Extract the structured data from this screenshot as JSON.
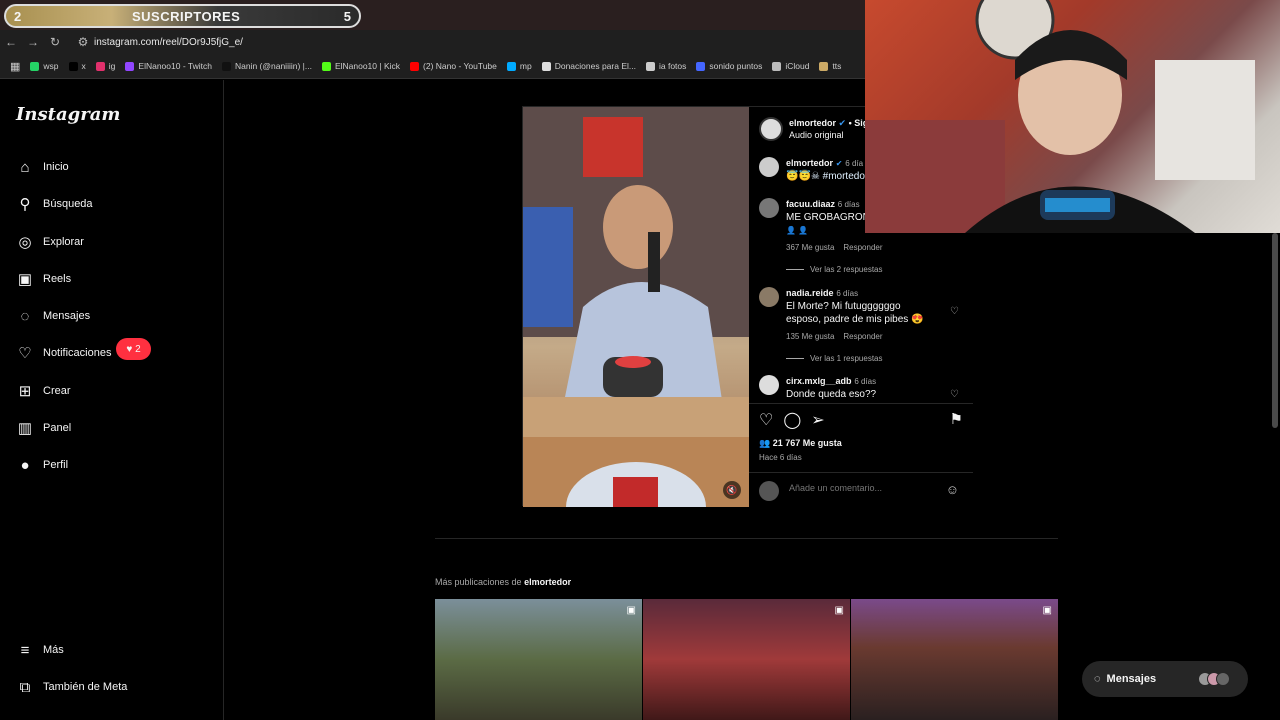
{
  "overlay": {
    "left_num": "2",
    "label": "SUSCRIPTORES",
    "right_num": "5"
  },
  "browser": {
    "url": "instagram.com/reel/DOr9J5fjG_e/"
  },
  "bookmarks": [
    {
      "label": "wsp",
      "color": "#25d366"
    },
    {
      "label": "x",
      "color": "#000000"
    },
    {
      "label": "ig",
      "color": "#e1306c"
    },
    {
      "label": "ElNanoo10 - Twitch",
      "color": "#9146ff"
    },
    {
      "label": "Nanin (@naniiiin) |...",
      "color": "#111111"
    },
    {
      "label": "ElNanoo10 | Kick",
      "color": "#53fc18"
    },
    {
      "label": "(2) Nano - YouTube",
      "color": "#ff0000"
    },
    {
      "label": "mp",
      "color": "#00aaff"
    },
    {
      "label": "Donaciones para El...",
      "color": "#dddddd"
    },
    {
      "label": "ia fotos",
      "color": "#cccccc"
    },
    {
      "label": "sonido puntos",
      "color": "#4466ff"
    },
    {
      "label": "iCloud",
      "color": "#bbbbbb"
    },
    {
      "label": "tts",
      "color": "#ccaa66"
    }
  ],
  "sidebar": {
    "logo": "Instagram",
    "items": [
      {
        "label": "Inicio",
        "icon": "⌂"
      },
      {
        "label": "Búsqueda",
        "icon": "⚲"
      },
      {
        "label": "Explorar",
        "icon": "◎"
      },
      {
        "label": "Reels",
        "icon": "▣"
      },
      {
        "label": "Mensajes",
        "icon": "◌"
      },
      {
        "label": "Notificaciones",
        "icon": "♡"
      },
      {
        "label": "Crear",
        "icon": "⊞"
      },
      {
        "label": "Panel",
        "icon": "▥"
      },
      {
        "label": "Perfil",
        "icon": "●"
      }
    ],
    "notif_count": "2",
    "more_label": "Más",
    "meta_label": "También de Meta"
  },
  "post": {
    "author": "elmortedor",
    "follow": "• Sig",
    "audio": "Audio original",
    "caption_author": "elmortedor",
    "caption_time": "6 día",
    "caption_text": "😇😇☠ #mortedo",
    "comments": [
      {
        "user": "facuu.diaaz",
        "time": "6 días",
        "text": "ME GROBAGRON",
        "extra": "👤 👤",
        "likes": "367 Me gusta",
        "reply": "Responder",
        "replies": "Ver las 2 respuestas"
      },
      {
        "user": "nadia.reide",
        "time": "6 días",
        "text": "El Morte? Mi futuggggggo esposo, padre de mis pibes 😍",
        "likes": "135 Me gusta",
        "reply": "Responder",
        "replies": "Ver las 1 respuestas"
      },
      {
        "user": "cirx.mxlg__adb",
        "time": "6 días",
        "text": "Donde queda eso??"
      }
    ],
    "likes": "21 767 Me gusta",
    "time_ago": "Hace 6 días",
    "comment_placeholder": "Añade un comentario..."
  },
  "more": {
    "prefix": "Más publicaciones de",
    "user": "elmortedor"
  },
  "messages_button": "Mensajes"
}
